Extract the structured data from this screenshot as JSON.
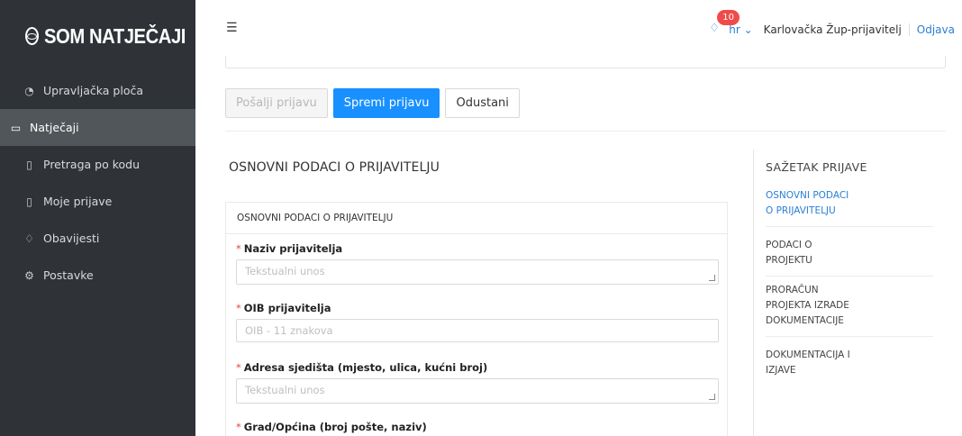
{
  "app": {
    "logo": "SOM NATJEČAJI"
  },
  "sidebar": {
    "items": [
      {
        "label": "Upravljačka ploča",
        "icon": "dashboard-icon"
      },
      {
        "label": "Natječaji",
        "icon": "folder-open-icon",
        "active": true
      },
      {
        "label": "Pretraga po kodu",
        "icon": "document-icon"
      },
      {
        "label": "Moje prijave",
        "icon": "file-check-icon"
      },
      {
        "label": "Obavijesti",
        "icon": "bell-icon"
      },
      {
        "label": "Postavke",
        "icon": "gear-icon"
      }
    ]
  },
  "header": {
    "notification_count": "10",
    "language": "hr",
    "user": "Karlovačka Žup-prijavitelj",
    "logout": "Odjava"
  },
  "actions": {
    "send": "Pošalji prijavu",
    "save": "Spremi prijavu",
    "cancel": "Odustani"
  },
  "form": {
    "section_title": "OSNOVNI PODACI O PRIJAVITELJU",
    "card_title": "OSNOVNI PODACI O PRIJAVITELJU",
    "fields": [
      {
        "label": "Naziv prijavitelja",
        "placeholder": "Tekstualni unos"
      },
      {
        "label": "OIB prijavitelja",
        "placeholder": "OIB - 11 znakova"
      },
      {
        "label": "Adresa sjedišta (mjesto, ulica, kućni broj)",
        "placeholder": "Tekstualni unos"
      },
      {
        "label": "Grad/Općina (broj pošte, naziv)"
      }
    ]
  },
  "summary": {
    "title": "SAŽETAK PRIJAVE",
    "items": [
      {
        "line1": "OSNOVNI PODACI",
        "line2": "O PRIJAVITELJU"
      },
      {
        "line1": "PODACI O",
        "line2": "PROJEKTU"
      },
      {
        "line1": "PRORAČUN",
        "line2": "PROJEKTA IZRADE",
        "line3": "DOKUMENTACIJE"
      },
      {
        "line1": "DOKUMENTACIJA I",
        "line2": "IZJAVE"
      }
    ]
  },
  "colors": {
    "accent": "#1890ff",
    "sidebar_bg": "#2f3338",
    "badge": "#f04a4a",
    "required": "#e04848"
  }
}
